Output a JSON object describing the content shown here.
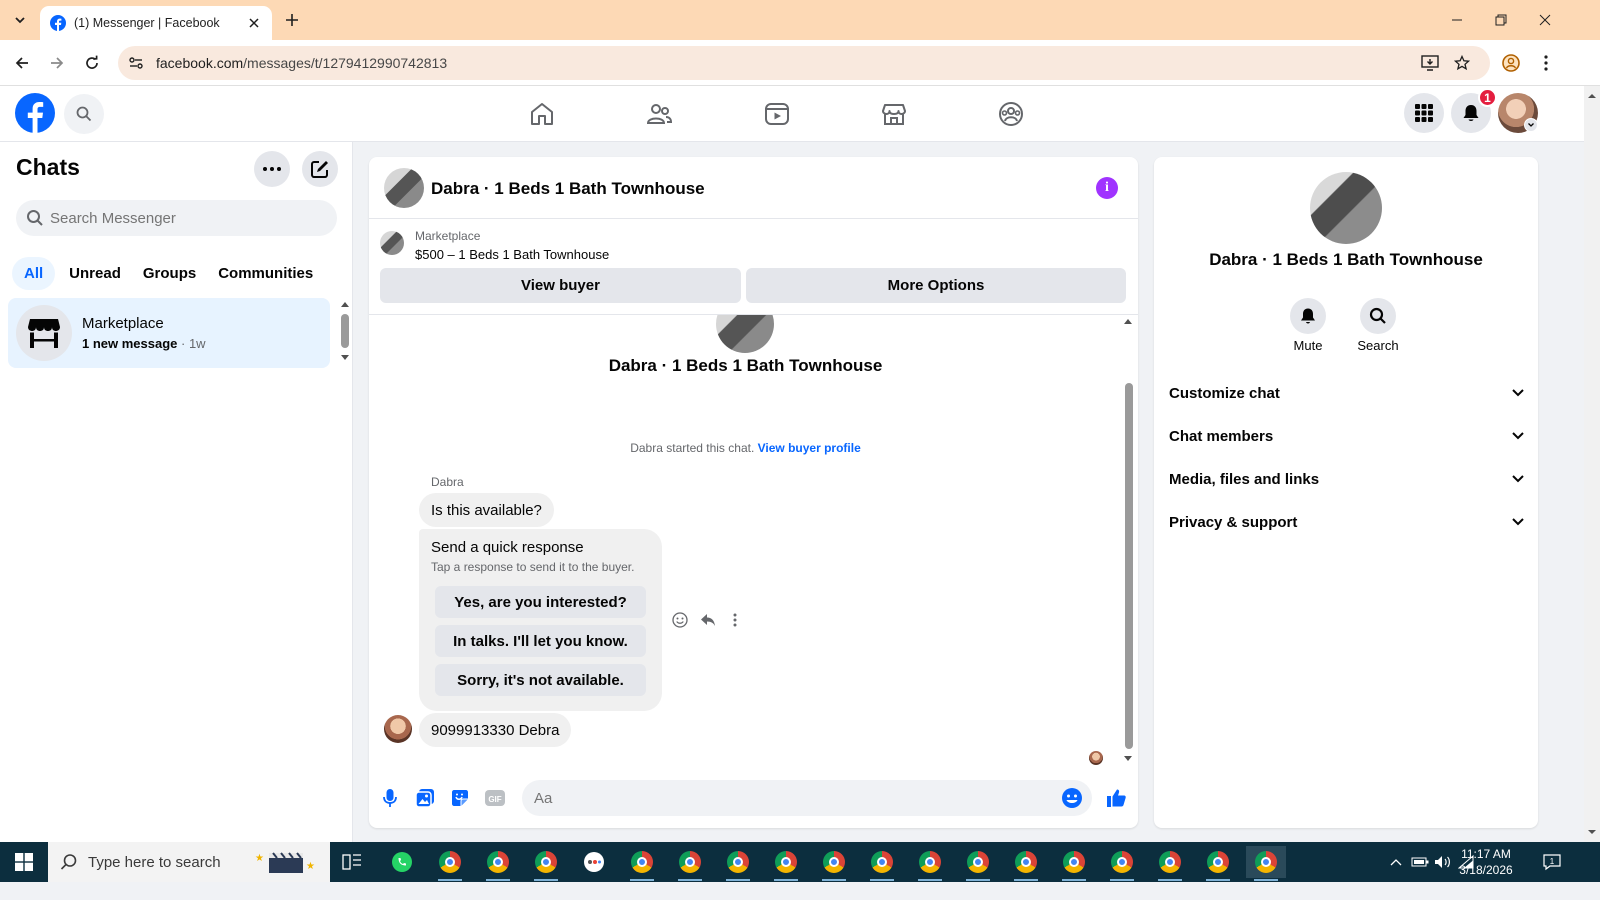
{
  "browser": {
    "tab_title": "(1) Messenger | Facebook",
    "url_host": "facebook.com",
    "url_path": "/messages/t/1279412990742813"
  },
  "header": {
    "notification_count": "1"
  },
  "sidebar": {
    "title": "Chats",
    "search_placeholder": "Search Messenger",
    "filters": [
      "All",
      "Unread",
      "Groups",
      "Communities"
    ],
    "active_filter": "All",
    "chats": [
      {
        "name": "Marketplace",
        "preview": "1 new message",
        "time": " · 1w"
      }
    ]
  },
  "conversation": {
    "title": "Dabra · 1 Beds 1 Bath Townhouse",
    "marketplace_label": "Marketplace",
    "listing": "$500 – 1 Beds 1 Bath Townhouse",
    "view_buyer_label": "View buyer",
    "more_options_label": "More Options",
    "intro_name": "Dabra · 1 Beds 1 Bath Townhouse",
    "started_text": "Dabra started this chat.",
    "view_profile_link": "View buyer profile",
    "sender_name": "Dabra",
    "message1": "Is this available?",
    "quick_title": "Send a quick response",
    "quick_subtitle": "Tap a response to send it to the buyer.",
    "quick_responses": [
      "Yes, are you interested?",
      "In talks. I'll let you know.",
      "Sorry, it's not available."
    ],
    "message2": "9099913330 Debra",
    "input_placeholder": "Aa"
  },
  "info_panel": {
    "name": "Dabra · 1 Beds 1 Bath Townhouse",
    "actions": [
      "Mute",
      "Search"
    ],
    "sections": [
      "Customize chat",
      "Chat members",
      "Media, files and links",
      "Privacy & support"
    ]
  },
  "taskbar": {
    "search_placeholder": "Type here to search",
    "time": "11:17 AM",
    "date": "3/18/2026"
  },
  "colors": {
    "fb_blue": "#0866ff",
    "info_purple": "#a033ff",
    "notif_red": "#e41e3f",
    "tabbar": "#fdd9b5",
    "taskbar": "#0c2e3e"
  }
}
